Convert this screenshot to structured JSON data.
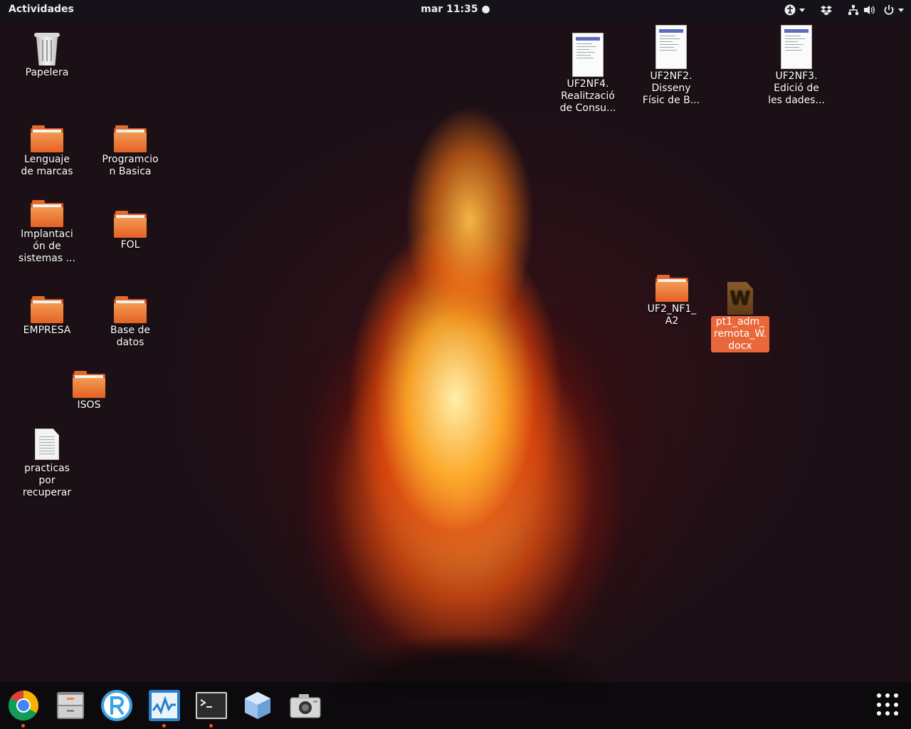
{
  "topbar": {
    "activities": "Actividades",
    "clock": "mar 11:35 ●",
    "tray_icons": [
      "accessibility-icon",
      "dropbox-icon",
      "network-icon",
      "volume-icon",
      "power-icon"
    ]
  },
  "desktop": {
    "icons": {
      "trash": "Papelera",
      "lenguaje": "Lenguaje\nde marcas",
      "programacion": "Programcio\nn Basica",
      "implantacion": "Implantaci\nón de\nsistemas ...",
      "fol": "FOL",
      "empresa": "EMPRESA",
      "basedatos": "Base de\ndatos",
      "isos": "ISOS",
      "practicas": "practicas\npor\nrecuperar",
      "uf2nf4": "UF2NF4.\nRealització\nde Consu...",
      "uf2nf2": "UF2NF2.\nDisseny\nFísic de B...",
      "uf2nf3": "UF2NF3.\nEdició de\nles dades...",
      "uf2nf1": "UF2_NF1_\nA2",
      "pt1": "pt1_adm_\nremota_W.\ndocx"
    },
    "word_letter": "W"
  },
  "dock": {
    "apps": [
      "chrome-icon",
      "files-icon",
      "remmina-icon",
      "system-monitor-icon",
      "terminal-icon",
      "virtualbox-icon",
      "screenshot-icon"
    ],
    "running": [
      "chrome",
      "system-monitor",
      "terminal"
    ]
  },
  "colors": {
    "accent": "#e95420",
    "selection": "#e9673a",
    "folder": "#e56125"
  }
}
